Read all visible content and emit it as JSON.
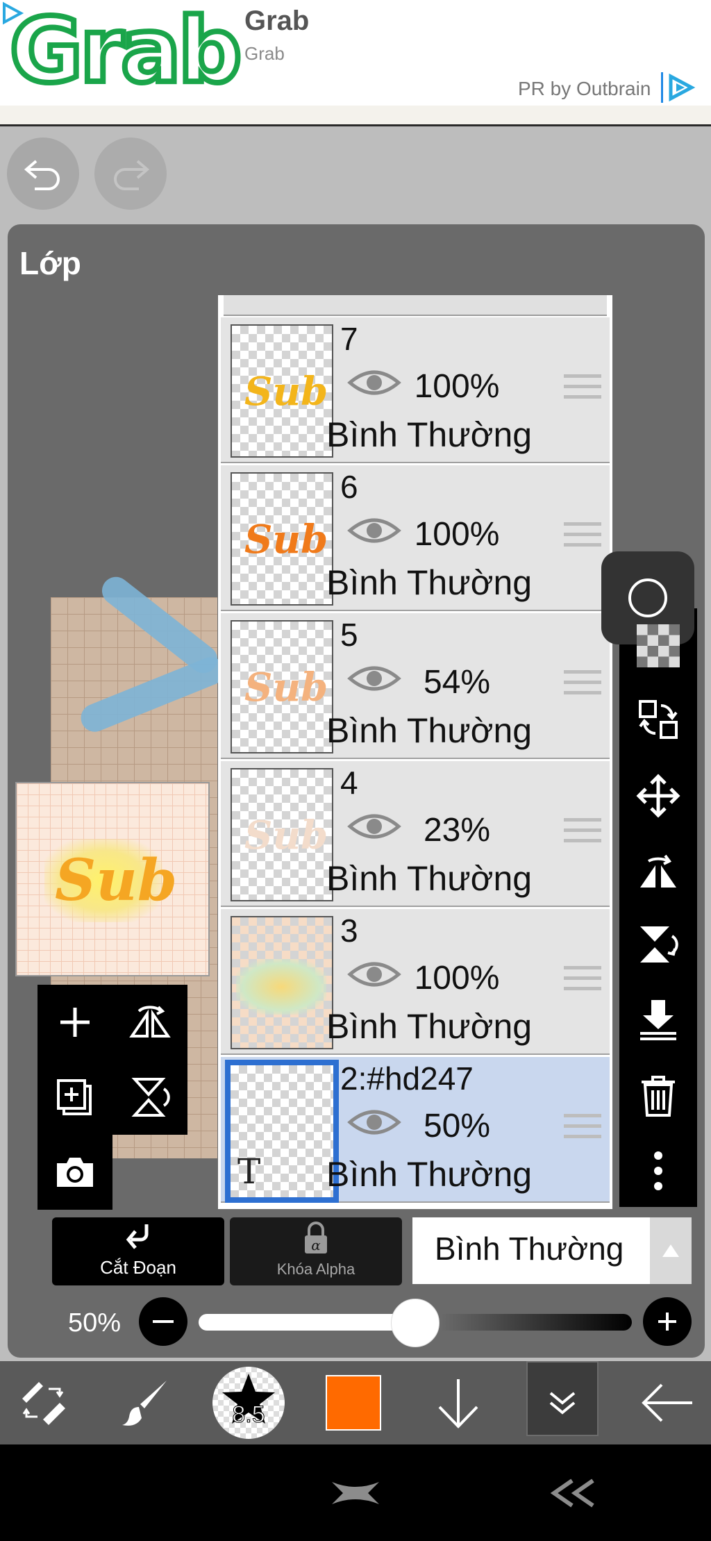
{
  "ad": {
    "logo": "Grab",
    "title": "Grab",
    "subtitle": "Grab",
    "pr_label": "PR by Outbrain",
    "brand_color": "#1aa54a"
  },
  "panel": {
    "title": "Lớp"
  },
  "layers": [
    {
      "name": "7",
      "opacity": "100%",
      "blend": "Bình Thường",
      "art": "Sub",
      "art_color": "#f3b51b"
    },
    {
      "name": "6",
      "opacity": "100%",
      "blend": "Bình Thường",
      "art": "Sub",
      "art_color": "#f07a1a"
    },
    {
      "name": "5",
      "opacity": "54%",
      "blend": "Bình Thường",
      "art": "Sub",
      "art_color": "#f4b27e"
    },
    {
      "name": "4",
      "opacity": "23%",
      "blend": "Bình Thường",
      "art": "Sub",
      "art_color": "#f3dccb"
    },
    {
      "name": "3",
      "opacity": "100%",
      "blend": "Bình Thường",
      "art": "",
      "art_color": "#f7d97a"
    },
    {
      "name": "2:#hd247",
      "opacity": "50%",
      "blend": "Bình Thường",
      "art": "",
      "art_color": "#d23a3a",
      "thumb_glyph": "T",
      "selected": true
    }
  ],
  "controls": {
    "clip_label": "Cắt Đoạn",
    "alpha_lock_label": "Khóa Alpha",
    "blend_mode": "Bình Thường",
    "opacity_label": "50%",
    "opacity_value": 0.5
  },
  "toolbar": {
    "brush_size": "8.5",
    "color": "#ff6a00"
  }
}
